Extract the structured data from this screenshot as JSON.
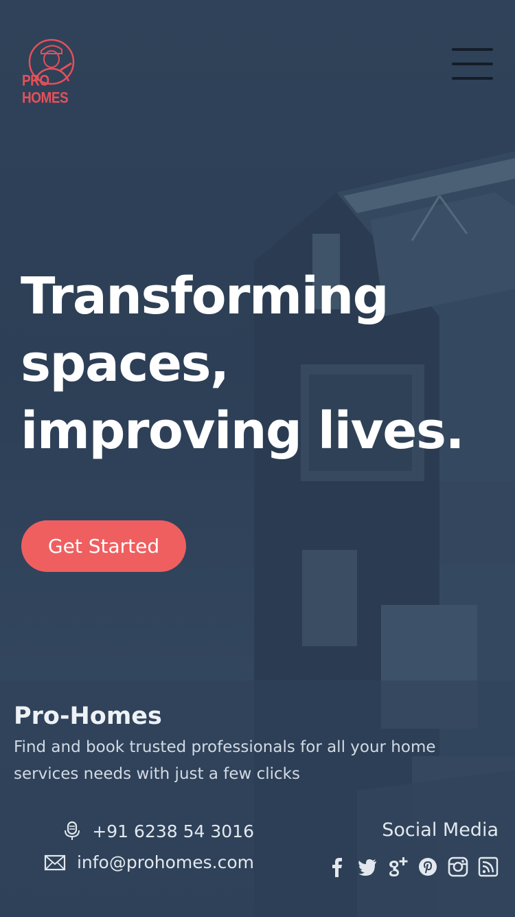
{
  "brand": {
    "logo_text": "PRO HOMES",
    "accent": "#ef5f60"
  },
  "hero": {
    "title_lines": [
      "Transforming",
      "spaces,",
      "improving lives."
    ],
    "cta_label": "Get Started"
  },
  "about": {
    "title": "Pro-Homes",
    "description": "Find and book trusted professionals for all your home services needs with just a few clicks"
  },
  "contact": {
    "phone": "+91 6238 54 3016",
    "email": "info@prohomes.com",
    "phone_icon": "microphone-icon",
    "email_icon": "envelope-icon"
  },
  "social": {
    "label": "Social Media",
    "icons": [
      "facebook-icon",
      "twitter-icon",
      "google-plus-icon",
      "pinterest-icon",
      "instagram-icon",
      "rss-icon"
    ]
  },
  "colors": {
    "background": "#2e4158",
    "text": "#ffffff",
    "menu_lines": "#151d28"
  }
}
